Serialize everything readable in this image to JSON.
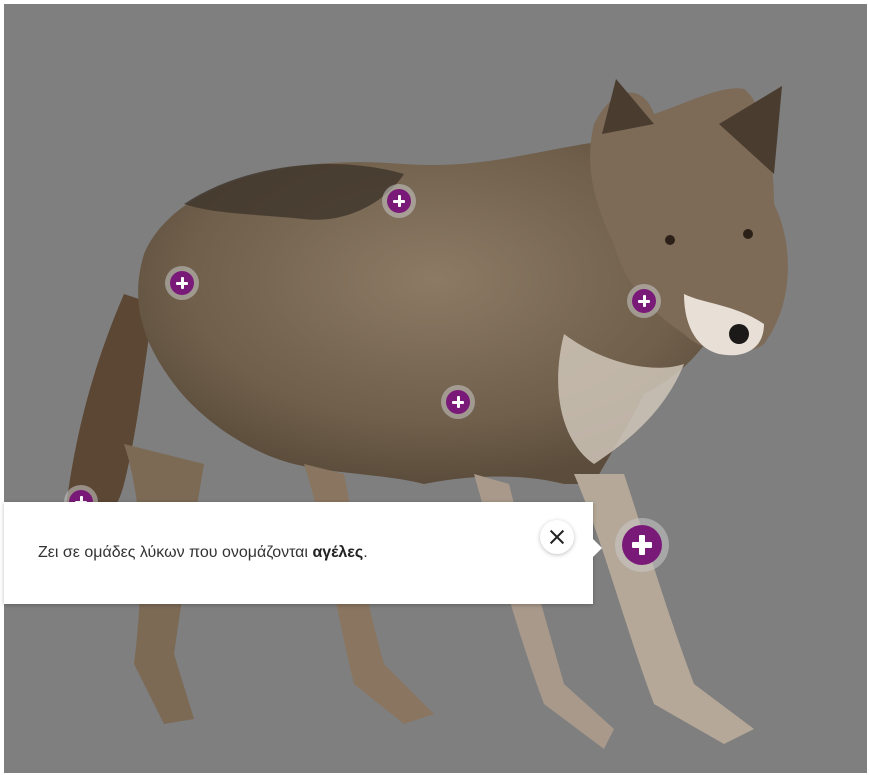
{
  "hotspots": [
    {
      "name": "hotspot-back"
    },
    {
      "name": "hotspot-shoulder"
    },
    {
      "name": "hotspot-head"
    },
    {
      "name": "hotspot-chest"
    },
    {
      "name": "hotspot-tail"
    },
    {
      "name": "hotspot-leg"
    }
  ],
  "popover": {
    "text_before": "Ζει σε ομάδες λύκων που ονομάζονται ",
    "text_bold": "αγέλες",
    "text_after": "."
  },
  "colors": {
    "overlay": "#7f7f7f",
    "hotspot": "#7a1a78",
    "popover_bg": "#ffffff"
  },
  "icons": {
    "hotspot": "plus-icon",
    "close": "close-icon"
  }
}
